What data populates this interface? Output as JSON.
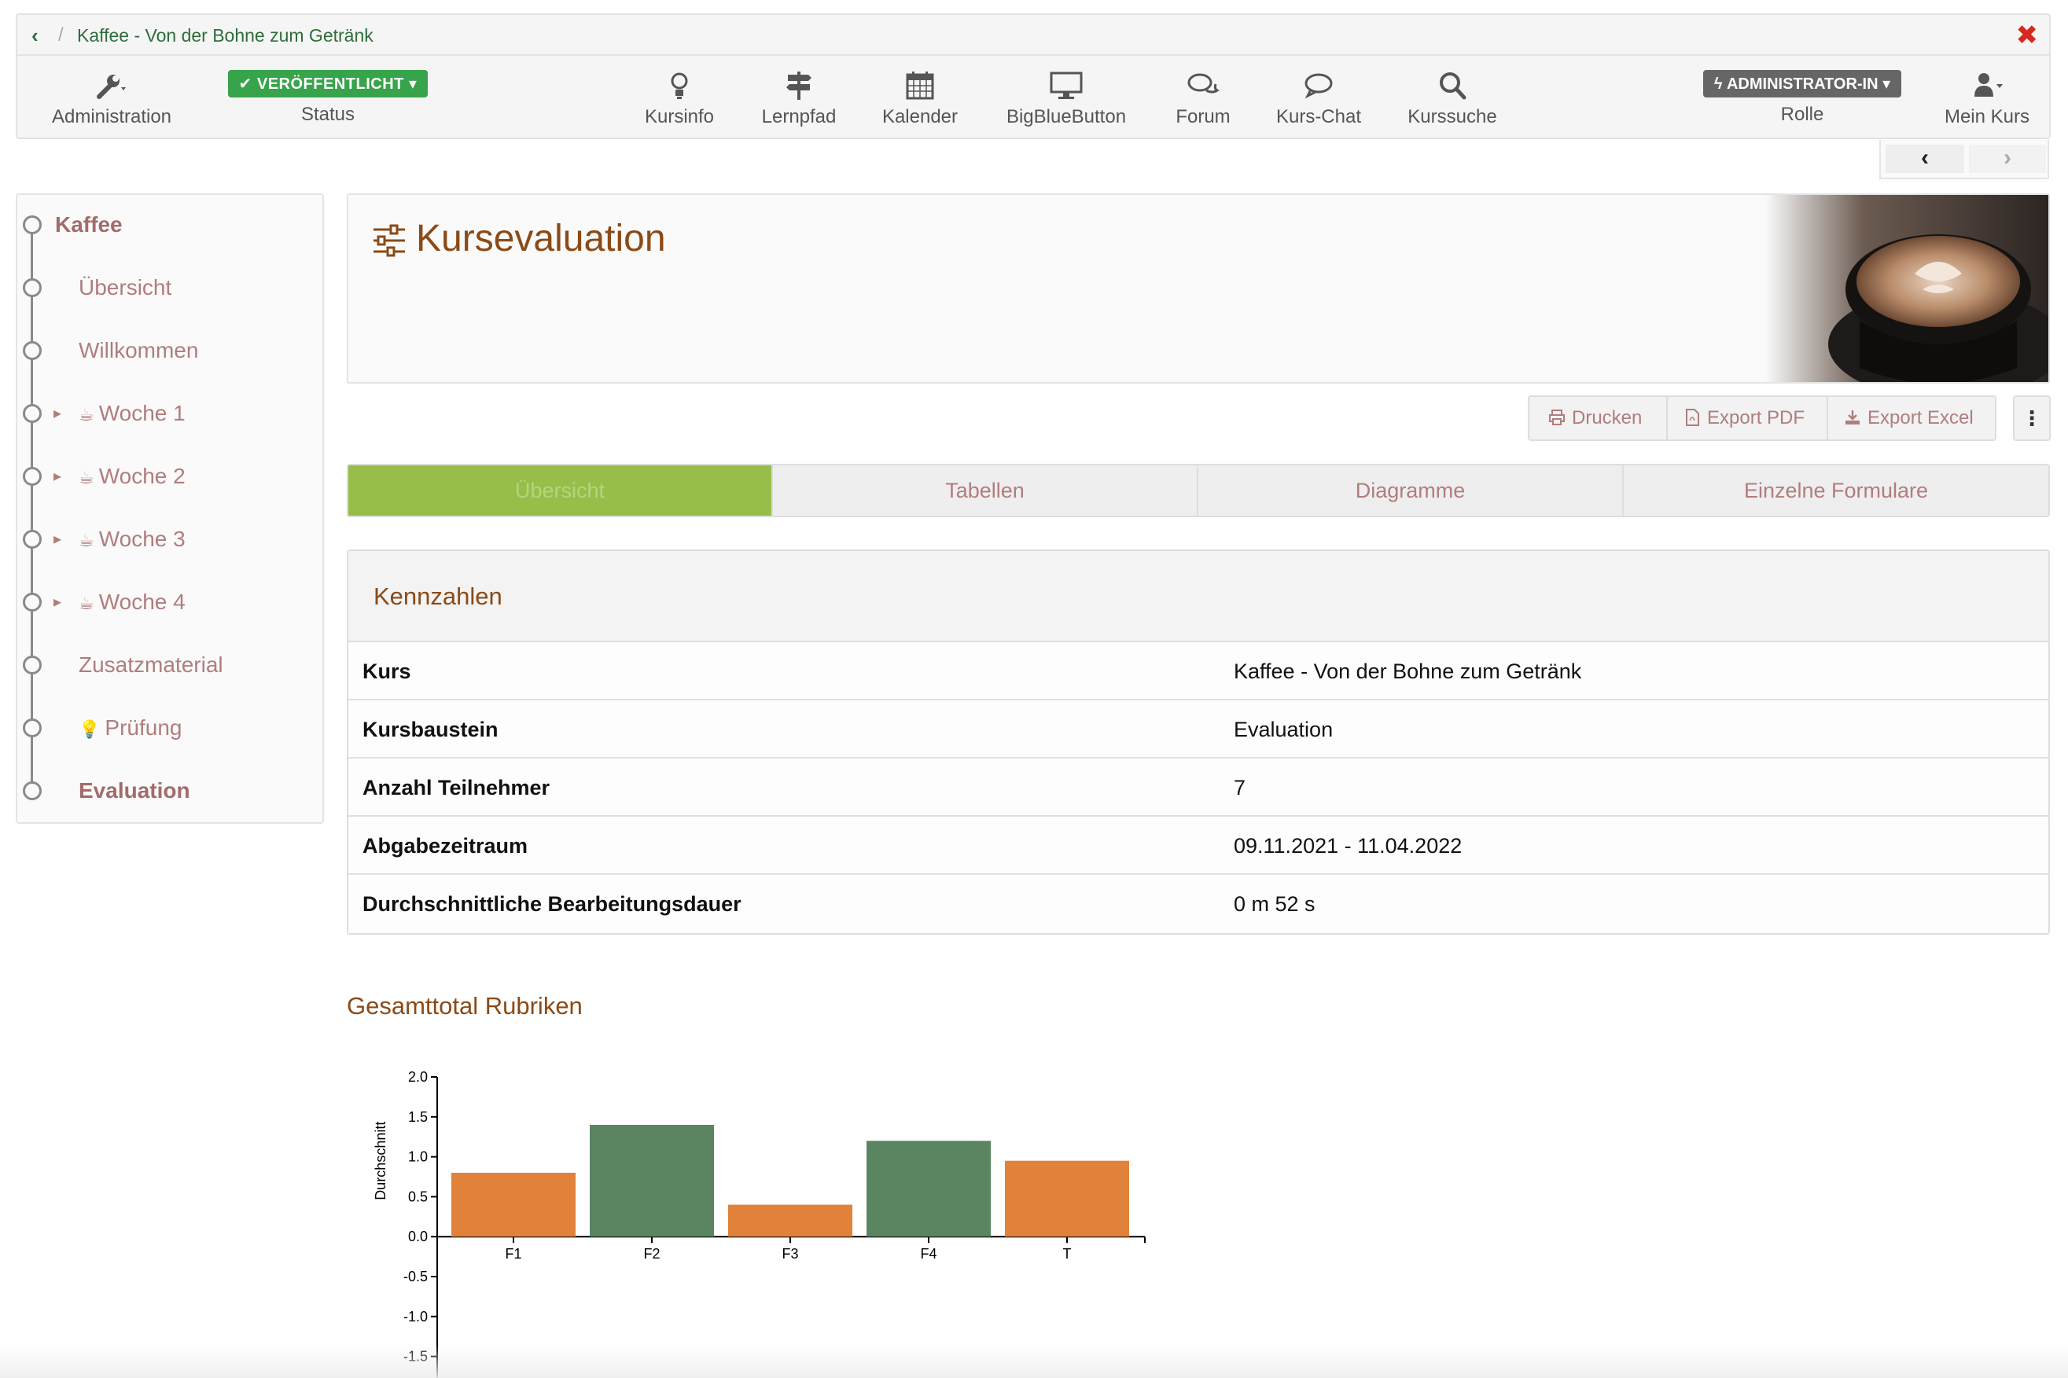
{
  "breadcrumb": {
    "title": "Kaffee - Von der Bohne zum Getränk"
  },
  "toolbar": {
    "administration": "Administration",
    "status_badge": "✔ VERÖFFENTLICHT ▾",
    "status_label": "Status",
    "tools": [
      {
        "label": "Kursinfo",
        "icon": "lightbulb-icon"
      },
      {
        "label": "Lernpfad",
        "icon": "signpost-icon"
      },
      {
        "label": "Kalender",
        "icon": "calendar-icon"
      },
      {
        "label": "BigBlueButton",
        "icon": "monitor-icon"
      },
      {
        "label": "Forum",
        "icon": "forum-icon"
      },
      {
        "label": "Kurs-Chat",
        "icon": "chat-icon"
      },
      {
        "label": "Kurssuche",
        "icon": "search-icon"
      }
    ],
    "role_badge": "ϟ ADMINISTRATOR-IN ▾",
    "role_label": "Rolle",
    "mycourse_label": "Mein Kurs"
  },
  "sidebar": {
    "items": [
      {
        "label": "Kaffee"
      },
      {
        "label": "Übersicht"
      },
      {
        "label": "Willkommen"
      },
      {
        "label": "Woche 1"
      },
      {
        "label": "Woche 2"
      },
      {
        "label": "Woche 3"
      },
      {
        "label": "Woche 4"
      },
      {
        "label": "Zusatzmaterial"
      },
      {
        "label": "Prüfung"
      },
      {
        "label": "Evaluation"
      }
    ]
  },
  "main": {
    "title": "Kursevaluation",
    "actions": {
      "print": "Drucken",
      "pdf": "Export PDF",
      "excel": "Export Excel"
    },
    "tabs": [
      "Übersicht",
      "Tabellen",
      "Diagramme",
      "Einzelne Formulare"
    ],
    "kennzahlen": {
      "title": "Kennzahlen",
      "rows": [
        {
          "key": "Kurs",
          "value": "Kaffee - Von der Bohne zum Getränk"
        },
        {
          "key": "Kursbaustein",
          "value": "Evaluation"
        },
        {
          "key": "Anzahl Teilnehmer",
          "value": "7"
        },
        {
          "key": "Abgabezeitraum",
          "value": "09.11.2021 - 11.04.2022"
        },
        {
          "key": "Durchschnittliche Bearbeitungsdauer",
          "value": "0 m 52 s"
        }
      ]
    },
    "chart_heading": "Gesamttotal Rubriken"
  },
  "colors": {
    "accent": "#8b4a16",
    "published": "#37a34a",
    "tab_active": "#98be4a",
    "bar_orange": "#e0823a",
    "bar_green": "#5a8560"
  },
  "chart_data": {
    "type": "bar",
    "categories": [
      "F1",
      "F2",
      "F3",
      "F4",
      "T"
    ],
    "values": [
      0.8,
      1.4,
      0.4,
      1.2,
      0.95
    ],
    "colors": [
      "#e0823a",
      "#5a8560",
      "#e0823a",
      "#5a8560",
      "#e0823a"
    ],
    "ylabel": "Durchschnitt",
    "yticks": [
      2.0,
      1.5,
      1.0,
      0.5,
      0.0,
      -0.5,
      -1.0,
      -1.5
    ],
    "ytick_labels": [
      "2.0",
      "1.5",
      "1.0",
      "0.5",
      "0.0",
      "-0.5",
      "-1.0",
      "-1.5"
    ],
    "ylim": [
      -1.5,
      2.0
    ]
  }
}
